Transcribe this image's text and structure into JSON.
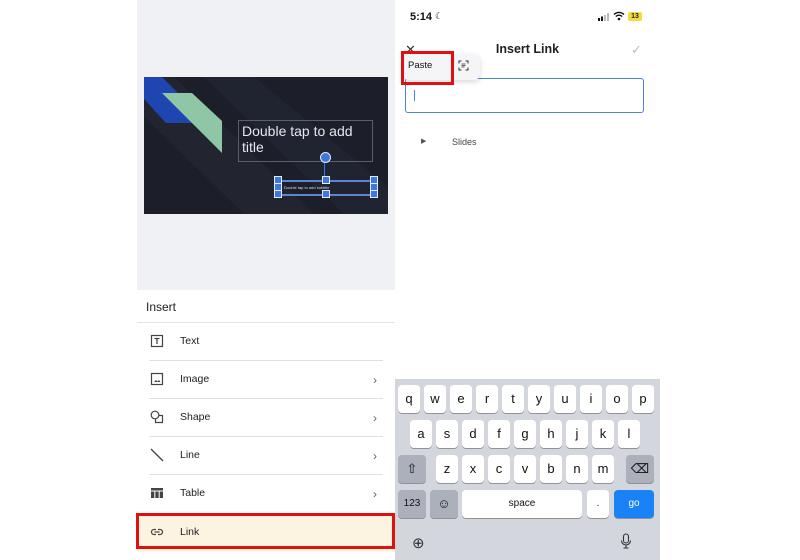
{
  "left_panel": {
    "slide": {
      "title_placeholder": "Double tap to add title",
      "subtitle_placeholder": "Double tap to add subtitle"
    },
    "insert_sheet": {
      "header": "Insert",
      "items": [
        {
          "label": "Text",
          "icon": "text-box-icon",
          "has_submenu": false
        },
        {
          "label": "Image",
          "icon": "image-icon",
          "has_submenu": true
        },
        {
          "label": "Shape",
          "icon": "shape-icon",
          "has_submenu": true
        },
        {
          "label": "Line",
          "icon": "line-icon",
          "has_submenu": true
        },
        {
          "label": "Table",
          "icon": "table-icon",
          "has_submenu": true
        },
        {
          "label": "Link",
          "icon": "link-icon",
          "has_submenu": false,
          "highlighted": true
        }
      ],
      "chevron": "›"
    }
  },
  "right_panel": {
    "status_bar": {
      "time": "5:14",
      "moon": "☾",
      "wifi": "≋",
      "battery": "13"
    },
    "nav": {
      "close": "✕",
      "title": "Insert Link",
      "confirm": "✓"
    },
    "link_input": {
      "value": "",
      "placeholder": ""
    },
    "context_menu": {
      "paste": "Paste",
      "scan": "⌗"
    },
    "slides_section": {
      "arrow": "▶",
      "label": "Slides"
    },
    "keyboard": {
      "row1": [
        "q",
        "w",
        "e",
        "r",
        "t",
        "y",
        "u",
        "i",
        "o",
        "p"
      ],
      "row2": [
        "a",
        "s",
        "d",
        "f",
        "g",
        "h",
        "j",
        "k",
        "l"
      ],
      "row3": [
        "z",
        "x",
        "c",
        "v",
        "b",
        "n",
        "m"
      ],
      "shift": "⇧",
      "backspace": "⌫",
      "numbers": "123",
      "emoji": "☺",
      "space": "space",
      "period": ".",
      "go": "go",
      "globe": "⊕",
      "mic": "🎙"
    }
  },
  "colors": {
    "highlight_red": "#e01010",
    "accent_blue": "#3d77e0",
    "go_key": "#1a82f7",
    "link_row_bg": "#fdf3e1",
    "slide_bg": "#1c1f2a",
    "slide_green": "#8fc6a5",
    "slide_blue": "#1e45b0"
  }
}
